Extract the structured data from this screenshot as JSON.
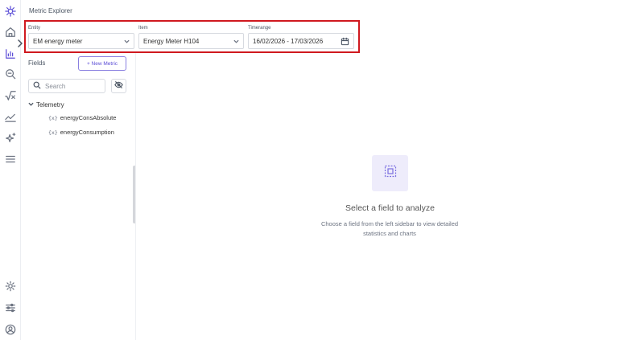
{
  "page": {
    "title": "Metric Explorer"
  },
  "colors": {
    "accent": "#5b4dd6",
    "highlight_border": "#d0191f",
    "empty_icon_bg": "#eeecfb"
  },
  "rail": {
    "icons": [
      "logo-icon",
      "home-icon",
      "chart-icon",
      "search-zoom-icon",
      "sqrt-icon",
      "trend-icon",
      "sparkle-icon",
      "menu-icon",
      "settings-icon",
      "sliders-icon",
      "user-icon"
    ],
    "active": "chart-icon"
  },
  "selectors": {
    "entity": {
      "label": "Entity",
      "value": "EM energy meter"
    },
    "item": {
      "label": "Item",
      "value": "Energy Meter H104"
    },
    "timerange": {
      "label": "Timerange",
      "value": "16/02/2026 - 17/03/2026"
    }
  },
  "sidebar": {
    "fields_label": "Fields",
    "new_metric_label": "+ New Metric",
    "search_placeholder": "Search",
    "groups": [
      {
        "name": "Telemetry",
        "items": [
          {
            "icon": "{x}",
            "label": "energyConsAbsolute"
          },
          {
            "icon": "{x}",
            "label": "energyConsumption"
          }
        ]
      }
    ]
  },
  "empty_state": {
    "title": "Select a field to analyze",
    "description": "Choose a field from the left sidebar to view detailed statistics and charts"
  }
}
